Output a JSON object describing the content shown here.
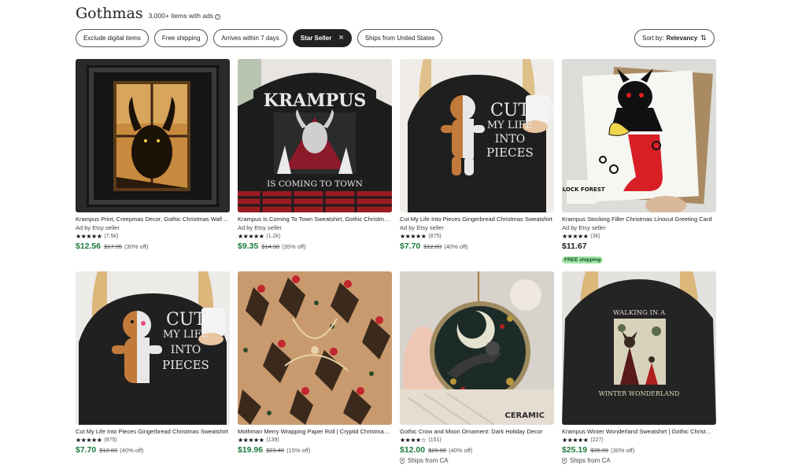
{
  "header": {
    "title": "Gothmas",
    "count": "3,000+ items with ads",
    "info_glyph": "i"
  },
  "filters": [
    {
      "label": "Exclude digital items",
      "active": false
    },
    {
      "label": "Free shipping",
      "active": false
    },
    {
      "label": "Arrives within 7 days",
      "active": false
    },
    {
      "label": "Star Seller",
      "active": true
    },
    {
      "label": "Ships from United States",
      "active": false
    }
  ],
  "sort": {
    "prefix": "Sort by:",
    "value": "Relevancy",
    "icon": "sort-arrows-icon"
  },
  "products": [
    {
      "title": "Krampus Print, Creepmas Decor, Gothic Christmas Wall Art",
      "ad": "Ad by Etsy seller",
      "stars": "★★★★★",
      "reviews": "(7.5k)",
      "price": "$12.56",
      "original": "$17.95",
      "discount": "(30% off)",
      "badge": "",
      "ships": ""
    },
    {
      "title": "Krampus Is Coming To Town Sweatshirt, Gothic Christmas Sweater",
      "ad": "Ad by Etsy seller",
      "stars": "★★★★★",
      "reviews": "(1.2k)",
      "price": "$9.35",
      "original": "$14.38",
      "discount": "(35% off)",
      "badge": "",
      "ships": ""
    },
    {
      "title": "Cut My Life Into Pieces Gingerbread Christmas Sweatshirt",
      "ad": "Ad by Etsy seller",
      "stars": "★★★★★",
      "reviews": "(875)",
      "price": "$7.70",
      "original": "$12.83",
      "discount": "(40% off)",
      "badge": "",
      "ships": ""
    },
    {
      "title": "Krampus Stocking Filler Christmas Linocut Greeting Card",
      "ad": "Ad by Etsy seller",
      "stars": "★★★★★",
      "reviews": "(3k)",
      "price": "$11.67",
      "original": "",
      "discount": "",
      "badge": "FREE shipping",
      "ships": ""
    },
    {
      "title": "Cut My Life Into Pieces Gingerbread Christmas Sweatshirt",
      "ad": "",
      "stars": "★★★★★",
      "reviews": "(875)",
      "price": "$7.70",
      "original": "$12.83",
      "discount": "(40% off)",
      "badge": "",
      "ships": ""
    },
    {
      "title": "Mothman Merry Wrapping Paper Roll | Cryptid Christmas Gift Wrap",
      "ad": "",
      "stars": "★★★★★",
      "reviews": "(139)",
      "price": "$19.96",
      "original": "$23.48",
      "discount": "(15% off)",
      "badge": "",
      "ships": ""
    },
    {
      "title": "Gothic Crow and Moon Ornament: Dark Holiday Decor",
      "ad": "",
      "stars": "★★★★☆",
      "reviews": "(151)",
      "price": "$12.00",
      "original": "$20.00",
      "discount": "(40% off)",
      "badge": "",
      "ships": "Ships from CA"
    },
    {
      "title": "Krampus Winter Wonderland Sweatshirt | Gothic Christmas",
      "ad": "",
      "stars": "★★★★★",
      "reviews": "(227)",
      "price": "$25.19",
      "original": "$35.99",
      "discount": "(30% off)",
      "badge": "",
      "ships": "Ships from CA"
    }
  ],
  "image_text": {
    "krampus_line1": "KRAMPUS",
    "krampus_line2": "IS COMING TO TOWN",
    "cut_line1": "CUT",
    "cut_line2": "MY LIFE",
    "cut_line3": "INTO",
    "cut_line4": "PIECES",
    "block_forest": "BLOCK FOREST",
    "ceramic": "CERAMIC",
    "walking": "WALKING IN A",
    "wonderland": "WINTER WONDERLAND"
  },
  "colors": {
    "sale_price": "#1b7b3b",
    "badge_bg": "#a3e6a8",
    "active_chip": "#222222"
  }
}
